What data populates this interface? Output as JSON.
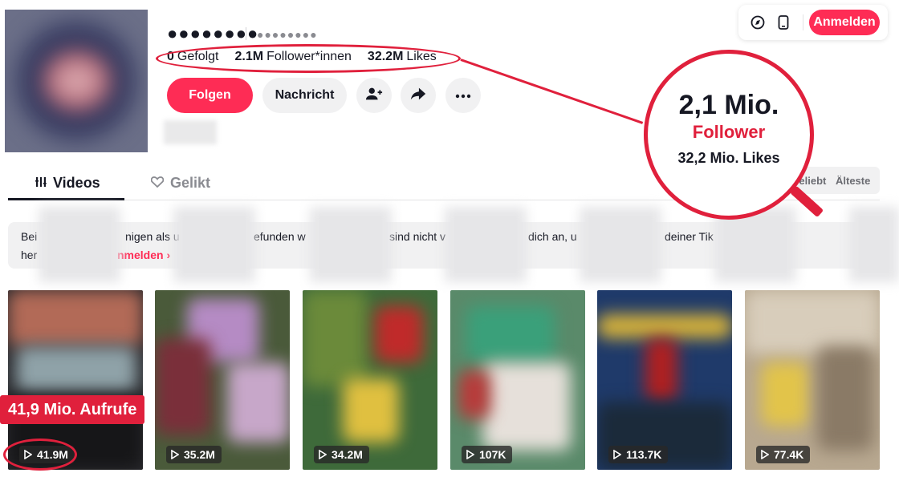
{
  "profile": {
    "username": "●●●●●●●●",
    "nickname": "●●●●●●●●",
    "stats": [
      {
        "value": "0",
        "label": "Gefolgt"
      },
      {
        "value": "2.1M",
        "label": "Follower*innen"
      },
      {
        "value": "32.2M",
        "label": "Likes"
      }
    ]
  },
  "actions": {
    "follow": "Folgen",
    "message": "Nachricht",
    "add_friend_icon": "person-add-icon",
    "share_icon": "share-icon",
    "more_icon": "more-icon"
  },
  "topbar": {
    "tiktok_icon": "compass-icon",
    "device_icon": "phone-icon",
    "login": "Anmelden"
  },
  "tabs": [
    {
      "label": "Videos",
      "icon": "grid-icon",
      "active": true
    },
    {
      "label": "Gelikt",
      "icon": "heart-icon",
      "active": false
    }
  ],
  "sort": {
    "popular": "Beliebt",
    "oldest": "Älteste"
  },
  "banner": {
    "line1_parts": [
      "Bei",
      "nigen als u",
      "efunden w",
      "sind nicht v",
      "dich an, u",
      "deiner Tik"
    ],
    "line2_start": "her",
    "link": "nmelden"
  },
  "videos": [
    {
      "views": "41.9M"
    },
    {
      "views": "35.2M"
    },
    {
      "views": "34.2M"
    },
    {
      "views": "107K"
    },
    {
      "views": "113.7K"
    },
    {
      "views": "77.4K"
    }
  ],
  "annotation": {
    "big": "2,1 Mio.",
    "follower": "Follower",
    "likes": "32,2 Mio. Likes",
    "views_label": "41,9 Mio. Aufrufe"
  },
  "colors": {
    "brand": "#fe2c55",
    "annotation": "#e0203c"
  }
}
